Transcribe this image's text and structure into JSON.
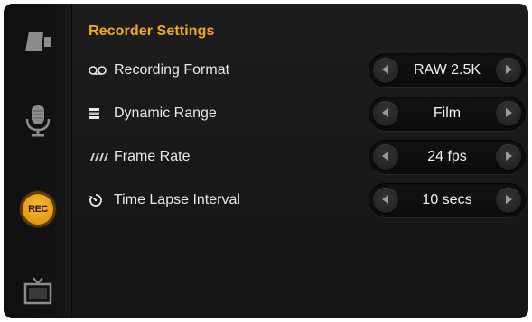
{
  "sidebar": {
    "items": [
      {
        "icon": "camera-icon"
      },
      {
        "icon": "microphone-icon"
      },
      {
        "icon": "record-icon",
        "label": "REC",
        "active": true
      },
      {
        "icon": "monitor-icon"
      }
    ]
  },
  "header": {
    "title": "Recorder Settings"
  },
  "settings": [
    {
      "label": "Recording Format",
      "icon": "tape-reel-icon",
      "value": "RAW 2.5K"
    },
    {
      "label": "Dynamic Range",
      "icon": "range-bars-icon",
      "value": "Film"
    },
    {
      "label": "Frame Rate",
      "icon": "film-frames-icon",
      "value": "24 fps"
    },
    {
      "label": "Time Lapse Interval",
      "icon": "timer-icon",
      "value": "10 secs"
    }
  ],
  "colors": {
    "accent": "#f0a81e",
    "rec_badge": "#e49b14",
    "text": "#e8e8e8",
    "icon_gray": "#8a8a8a"
  }
}
